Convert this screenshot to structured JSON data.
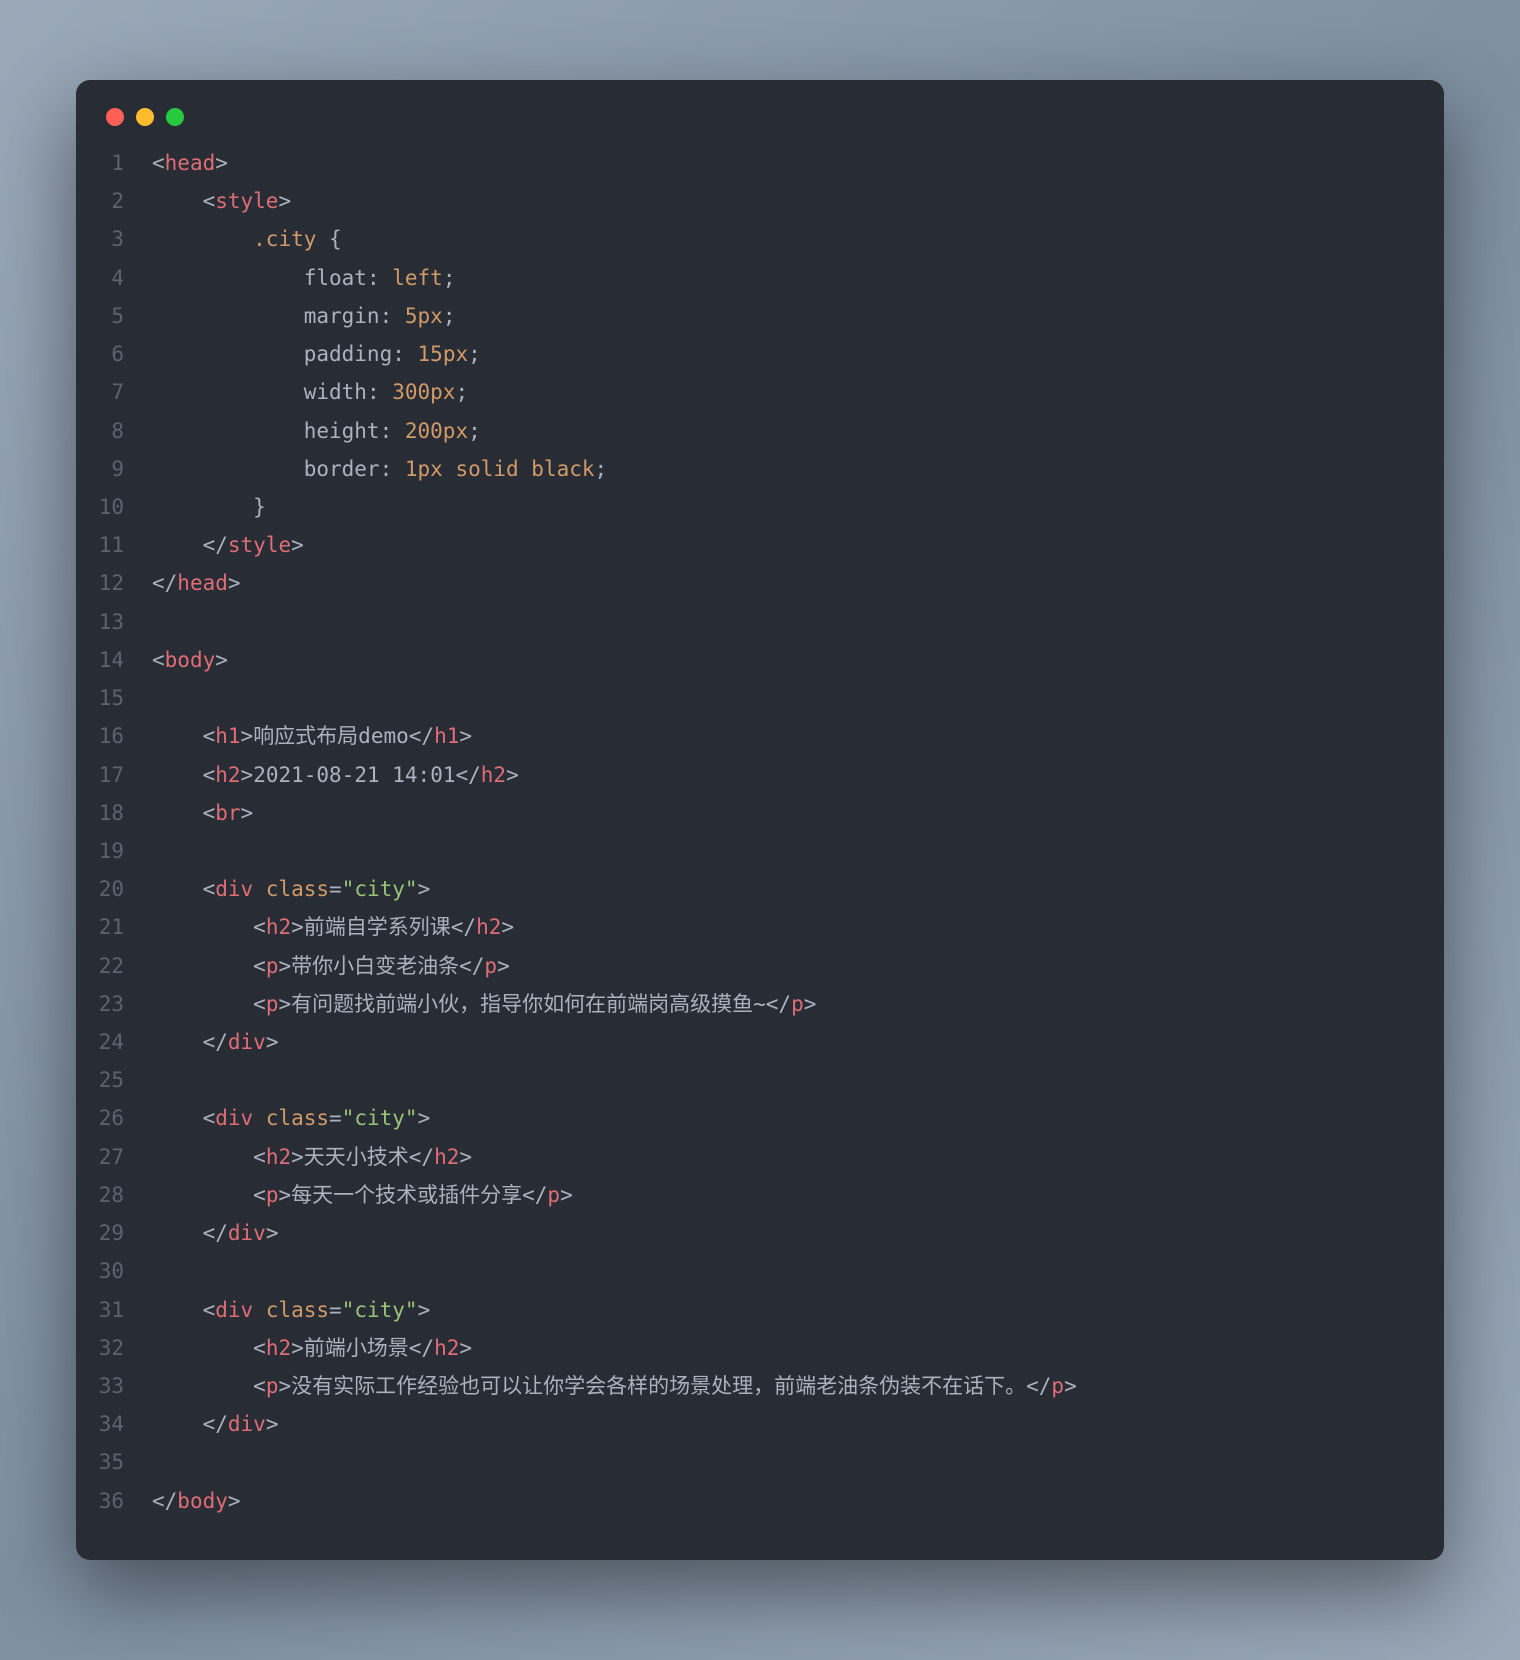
{
  "titlebar": {
    "dots": [
      "red",
      "yellow",
      "green"
    ]
  },
  "lines": [
    {
      "n": "1",
      "ind": 0,
      "seg": [
        [
          "punct",
          "<"
        ],
        [
          "tag",
          "head"
        ],
        [
          "punct",
          ">"
        ]
      ]
    },
    {
      "n": "2",
      "ind": 1,
      "seg": [
        [
          "punct",
          "<"
        ],
        [
          "tag",
          "style"
        ],
        [
          "punct",
          ">"
        ]
      ]
    },
    {
      "n": "3",
      "ind": 2,
      "seg": [
        [
          "sel",
          ".city"
        ],
        [
          "txt",
          " {"
        ]
      ]
    },
    {
      "n": "4",
      "ind": 3,
      "seg": [
        [
          "prop",
          "float"
        ],
        [
          "txt",
          ": "
        ],
        [
          "val",
          "left"
        ],
        [
          "txt",
          ";"
        ]
      ]
    },
    {
      "n": "5",
      "ind": 3,
      "seg": [
        [
          "prop",
          "margin"
        ],
        [
          "txt",
          ": "
        ],
        [
          "val",
          "5px"
        ],
        [
          "txt",
          ";"
        ]
      ]
    },
    {
      "n": "6",
      "ind": 3,
      "seg": [
        [
          "prop",
          "padding"
        ],
        [
          "txt",
          ": "
        ],
        [
          "val",
          "15px"
        ],
        [
          "txt",
          ";"
        ]
      ]
    },
    {
      "n": "7",
      "ind": 3,
      "seg": [
        [
          "prop",
          "width"
        ],
        [
          "txt",
          ": "
        ],
        [
          "val",
          "300px"
        ],
        [
          "txt",
          ";"
        ]
      ]
    },
    {
      "n": "8",
      "ind": 3,
      "seg": [
        [
          "prop",
          "height"
        ],
        [
          "txt",
          ": "
        ],
        [
          "val",
          "200px"
        ],
        [
          "txt",
          ";"
        ]
      ]
    },
    {
      "n": "9",
      "ind": 3,
      "seg": [
        [
          "prop",
          "border"
        ],
        [
          "txt",
          ": "
        ],
        [
          "val",
          "1px solid black"
        ],
        [
          "txt",
          ";"
        ]
      ]
    },
    {
      "n": "10",
      "ind": 2,
      "seg": [
        [
          "txt",
          "}"
        ]
      ]
    },
    {
      "n": "11",
      "ind": 1,
      "seg": [
        [
          "punct",
          "</"
        ],
        [
          "tag",
          "style"
        ],
        [
          "punct",
          ">"
        ]
      ]
    },
    {
      "n": "12",
      "ind": 0,
      "seg": [
        [
          "punct",
          "</"
        ],
        [
          "tag",
          "head"
        ],
        [
          "punct",
          ">"
        ]
      ]
    },
    {
      "n": "13",
      "ind": 0,
      "seg": []
    },
    {
      "n": "14",
      "ind": 0,
      "seg": [
        [
          "punct",
          "<"
        ],
        [
          "tag",
          "body"
        ],
        [
          "punct",
          ">"
        ]
      ]
    },
    {
      "n": "15",
      "ind": 0,
      "seg": []
    },
    {
      "n": "16",
      "ind": 1,
      "seg": [
        [
          "punct",
          "<"
        ],
        [
          "tag",
          "h1"
        ],
        [
          "punct",
          ">"
        ],
        [
          "txt",
          "响应式布局demo"
        ],
        [
          "punct",
          "</"
        ],
        [
          "tag",
          "h1"
        ],
        [
          "punct",
          ">"
        ]
      ]
    },
    {
      "n": "17",
      "ind": 1,
      "seg": [
        [
          "punct",
          "<"
        ],
        [
          "tag",
          "h2"
        ],
        [
          "punct",
          ">"
        ],
        [
          "txt",
          "2021-08-21 14:01"
        ],
        [
          "punct",
          "</"
        ],
        [
          "tag",
          "h2"
        ],
        [
          "punct",
          ">"
        ]
      ]
    },
    {
      "n": "18",
      "ind": 1,
      "seg": [
        [
          "punct",
          "<"
        ],
        [
          "tag",
          "br"
        ],
        [
          "punct",
          ">"
        ]
      ]
    },
    {
      "n": "19",
      "ind": 0,
      "seg": []
    },
    {
      "n": "20",
      "ind": 1,
      "seg": [
        [
          "punct",
          "<"
        ],
        [
          "tag",
          "div"
        ],
        [
          "txt",
          " "
        ],
        [
          "attr",
          "class"
        ],
        [
          "punct",
          "="
        ],
        [
          "str",
          "\"city\""
        ],
        [
          "punct",
          ">"
        ]
      ]
    },
    {
      "n": "21",
      "ind": 2,
      "seg": [
        [
          "punct",
          "<"
        ],
        [
          "tag",
          "h2"
        ],
        [
          "punct",
          ">"
        ],
        [
          "txt",
          "前端自学系列课"
        ],
        [
          "punct",
          "</"
        ],
        [
          "tag",
          "h2"
        ],
        [
          "punct",
          ">"
        ]
      ]
    },
    {
      "n": "22",
      "ind": 2,
      "seg": [
        [
          "punct",
          "<"
        ],
        [
          "tag",
          "p"
        ],
        [
          "punct",
          ">"
        ],
        [
          "txt",
          "带你小白变老油条"
        ],
        [
          "punct",
          "</"
        ],
        [
          "tag",
          "p"
        ],
        [
          "punct",
          ">"
        ]
      ]
    },
    {
      "n": "23",
      "ind": 2,
      "seg": [
        [
          "punct",
          "<"
        ],
        [
          "tag",
          "p"
        ],
        [
          "punct",
          ">"
        ],
        [
          "txt",
          "有问题找前端小伙，指导你如何在前端岗高级摸鱼~"
        ],
        [
          "punct",
          "</"
        ],
        [
          "tag",
          "p"
        ],
        [
          "punct",
          ">"
        ]
      ]
    },
    {
      "n": "24",
      "ind": 1,
      "seg": [
        [
          "punct",
          "</"
        ],
        [
          "tag",
          "div"
        ],
        [
          "punct",
          ">"
        ]
      ]
    },
    {
      "n": "25",
      "ind": 0,
      "seg": []
    },
    {
      "n": "26",
      "ind": 1,
      "seg": [
        [
          "punct",
          "<"
        ],
        [
          "tag",
          "div"
        ],
        [
          "txt",
          " "
        ],
        [
          "attr",
          "class"
        ],
        [
          "punct",
          "="
        ],
        [
          "str",
          "\"city\""
        ],
        [
          "punct",
          ">"
        ]
      ]
    },
    {
      "n": "27",
      "ind": 2,
      "seg": [
        [
          "punct",
          "<"
        ],
        [
          "tag",
          "h2"
        ],
        [
          "punct",
          ">"
        ],
        [
          "txt",
          "天天小技术"
        ],
        [
          "punct",
          "</"
        ],
        [
          "tag",
          "h2"
        ],
        [
          "punct",
          ">"
        ]
      ]
    },
    {
      "n": "28",
      "ind": 2,
      "seg": [
        [
          "punct",
          "<"
        ],
        [
          "tag",
          "p"
        ],
        [
          "punct",
          ">"
        ],
        [
          "txt",
          "每天一个技术或插件分享"
        ],
        [
          "punct",
          "</"
        ],
        [
          "tag",
          "p"
        ],
        [
          "punct",
          ">"
        ]
      ]
    },
    {
      "n": "29",
      "ind": 1,
      "seg": [
        [
          "punct",
          "</"
        ],
        [
          "tag",
          "div"
        ],
        [
          "punct",
          ">"
        ]
      ]
    },
    {
      "n": "30",
      "ind": 0,
      "seg": []
    },
    {
      "n": "31",
      "ind": 1,
      "seg": [
        [
          "punct",
          "<"
        ],
        [
          "tag",
          "div"
        ],
        [
          "txt",
          " "
        ],
        [
          "attr",
          "class"
        ],
        [
          "punct",
          "="
        ],
        [
          "str",
          "\"city\""
        ],
        [
          "punct",
          ">"
        ]
      ]
    },
    {
      "n": "32",
      "ind": 2,
      "seg": [
        [
          "punct",
          "<"
        ],
        [
          "tag",
          "h2"
        ],
        [
          "punct",
          ">"
        ],
        [
          "txt",
          "前端小场景"
        ],
        [
          "punct",
          "</"
        ],
        [
          "tag",
          "h2"
        ],
        [
          "punct",
          ">"
        ]
      ]
    },
    {
      "n": "33",
      "ind": 2,
      "seg": [
        [
          "punct",
          "<"
        ],
        [
          "tag",
          "p"
        ],
        [
          "punct",
          ">"
        ],
        [
          "txt",
          "没有实际工作经验也可以让你学会各样的场景处理，前端老油条伪装不在话下。"
        ],
        [
          "punct",
          "</"
        ],
        [
          "tag",
          "p"
        ],
        [
          "punct",
          ">"
        ]
      ]
    },
    {
      "n": "34",
      "ind": 1,
      "seg": [
        [
          "punct",
          "</"
        ],
        [
          "tag",
          "div"
        ],
        [
          "punct",
          ">"
        ]
      ]
    },
    {
      "n": "35",
      "ind": 0,
      "seg": []
    },
    {
      "n": "36",
      "ind": 0,
      "seg": [
        [
          "punct",
          "</"
        ],
        [
          "tag",
          "body"
        ],
        [
          "punct",
          ">"
        ]
      ]
    }
  ]
}
